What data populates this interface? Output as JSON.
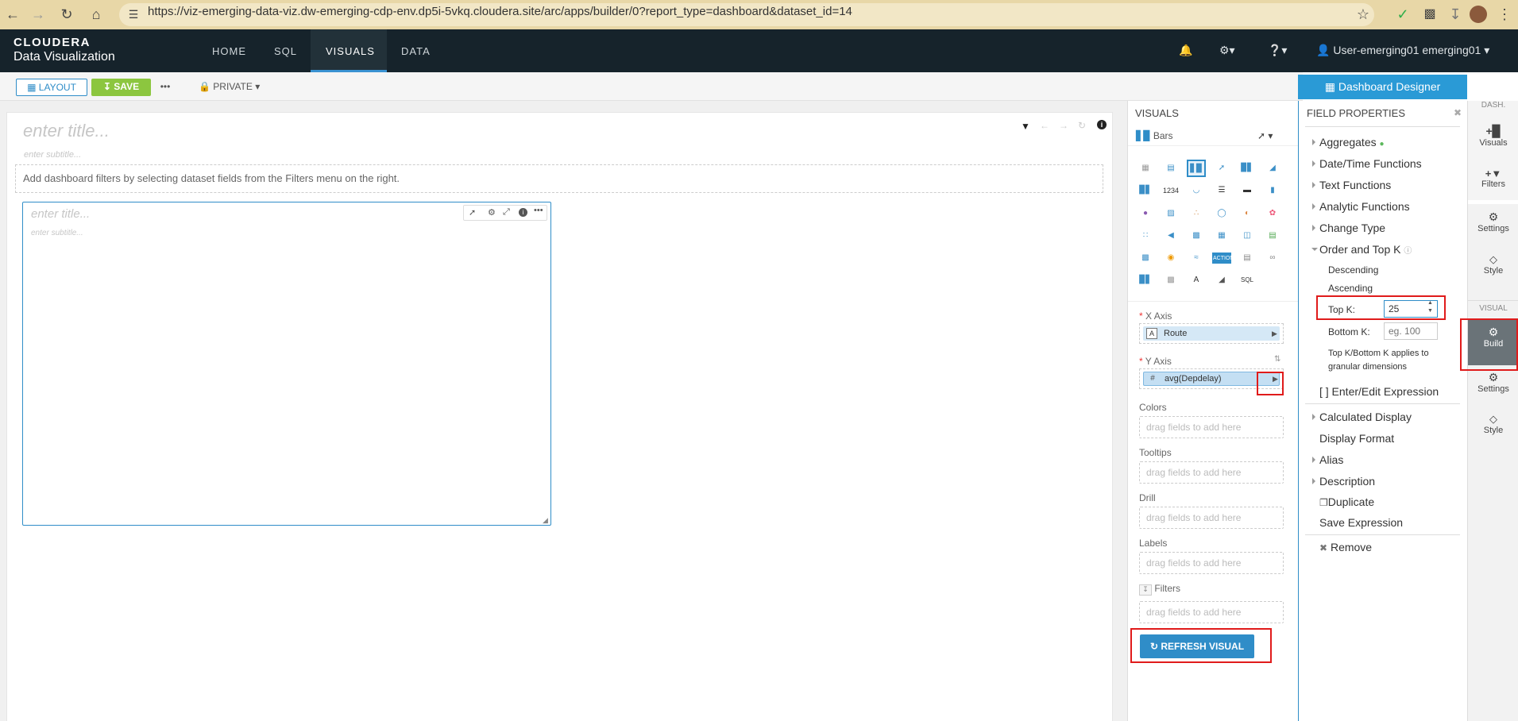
{
  "browser": {
    "url": "https://viz-emerging-data-viz.dw-emerging-cdp-env.dp5i-5vkq.cloudera.site/arc/apps/builder/0?report_type=dashboard&dataset_id=14"
  },
  "header": {
    "logo_line1": "CLOUDERA",
    "logo_line2": "Data Visualization",
    "nav": [
      "HOME",
      "SQL",
      "VISUALS",
      "DATA"
    ],
    "active_nav": "VISUALS",
    "user": "User-emerging01 emerging01"
  },
  "toolbar": {
    "layout_label": "LAYOUT",
    "save_label": "SAVE",
    "more_label": "•••",
    "private_label": "PRIVATE"
  },
  "dashboard": {
    "title_placeholder": "enter title...",
    "subtitle_placeholder": "enter subtitle...",
    "filters_hint": "Add dashboard filters by selecting dataset fields from the Filters menu on the right.",
    "visual_title_placeholder": "enter title...",
    "visual_subtitle_placeholder": "enter subtitle..."
  },
  "visuals_panel": {
    "heading": "VISUALS",
    "selected_type": "Bars",
    "x_axis_label": "X Axis",
    "x_axis_field": "Route",
    "y_axis_label": "Y Axis",
    "y_axis_field": "avg(Depdelay)",
    "colors_label": "Colors",
    "tooltips_label": "Tooltips",
    "drill_label": "Drill",
    "labels_label": "Labels",
    "filters_label": "Filters",
    "drag_hint": "drag fields to add here",
    "refresh_label": "REFRESH VISUAL",
    "icon_number_label": "1234",
    "icon_sql_label": "SQL",
    "icon_action_label": "ACTION"
  },
  "designer": {
    "header": "Dashboard Designer"
  },
  "field_properties": {
    "heading": "FIELD PROPERTIES",
    "items": {
      "aggregates": "Aggregates",
      "datetime": "Date/Time Functions",
      "text": "Text Functions",
      "analytic": "Analytic Functions",
      "change_type": "Change Type",
      "order_topk": "Order and Top K",
      "descending": "Descending",
      "ascending": "Ascending",
      "topk_label": "Top K:",
      "topk_value": "25",
      "bottomk_label": "Bottom K:",
      "bottomk_placeholder": "eg. 100",
      "topk_note": "Top K/Bottom K applies to granular dimensions",
      "enter_edit_expr": "[ ] Enter/Edit Expression",
      "calculated_display": "Calculated Display",
      "display_format": "Display Format",
      "alias": "Alias",
      "description": "Description",
      "duplicate": "Duplicate",
      "save_expression": "Save Expression",
      "remove": "Remove"
    }
  },
  "rail": {
    "dash_label": "DASH.",
    "visuals": "Visuals",
    "filters": "Filters",
    "settings": "Settings",
    "style": "Style",
    "visual_label": "VISUAL",
    "build": "Build",
    "settings2": "Settings",
    "style2": "Style"
  },
  "colors": {
    "accent": "#2f8dc8",
    "save_green": "#8cc63f",
    "header_bg": "#16232b",
    "highlight_red": "#e01b1b"
  }
}
